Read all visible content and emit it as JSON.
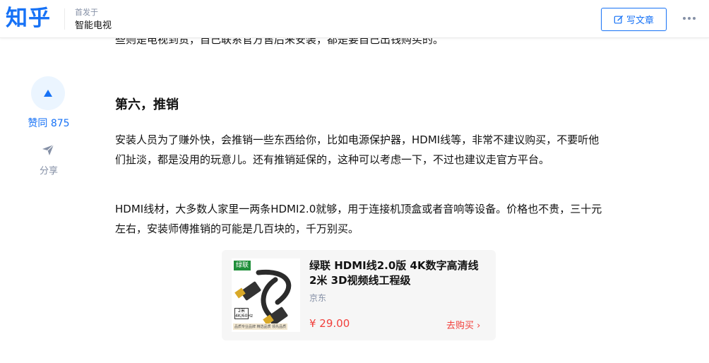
{
  "header": {
    "logo": "知乎",
    "published_label": "首发于",
    "column_name": "智能电视",
    "write_button": "写文章",
    "more_icon": "more-dots-icon"
  },
  "article": {
    "cut_line": "些则是电视到货，自己联系官方售后来安装，都是要自己出钱购买的。",
    "heading": "第六，推销",
    "paragraph1": "安装人员为了赚外快，会推销一些东西给你，比如电源保护器，HDMI线等，非常不建议购买，不要听他们扯淡，都是没用的玩意儿。还有推销延保的，这种可以考虑一下，不过也建议走官方平台。",
    "paragraph2": "HDMI线材，大多数人家里一两条HDMI2.0就够，用于连接机顶盒或者音响等设备。价格也不贵，三十元左右，安装师傅推销的可能是几百块的，千万别买。"
  },
  "sidebar": {
    "vote_label": "赞同 875",
    "vote_icon": "upvote-triangle-icon",
    "share_label": "分享",
    "share_icon": "paper-plane-icon"
  },
  "product_card": {
    "image_brand_tag": "绿联",
    "image_spec": "2米 4K/60Hz",
    "image_note": "品质专业品牌 精选品质 领先品质",
    "title": "绿联 HDMI线2.0版 4K数字高清线 2米 3D视频线工程级",
    "shop": "京东",
    "price": "¥ 29.00",
    "buy_link": "去购买 ›"
  },
  "colors": {
    "brand_blue": "#1772f6",
    "vote_bg": "#ebf5ff",
    "price_red": "#f1403c",
    "muted": "#8590a6"
  }
}
